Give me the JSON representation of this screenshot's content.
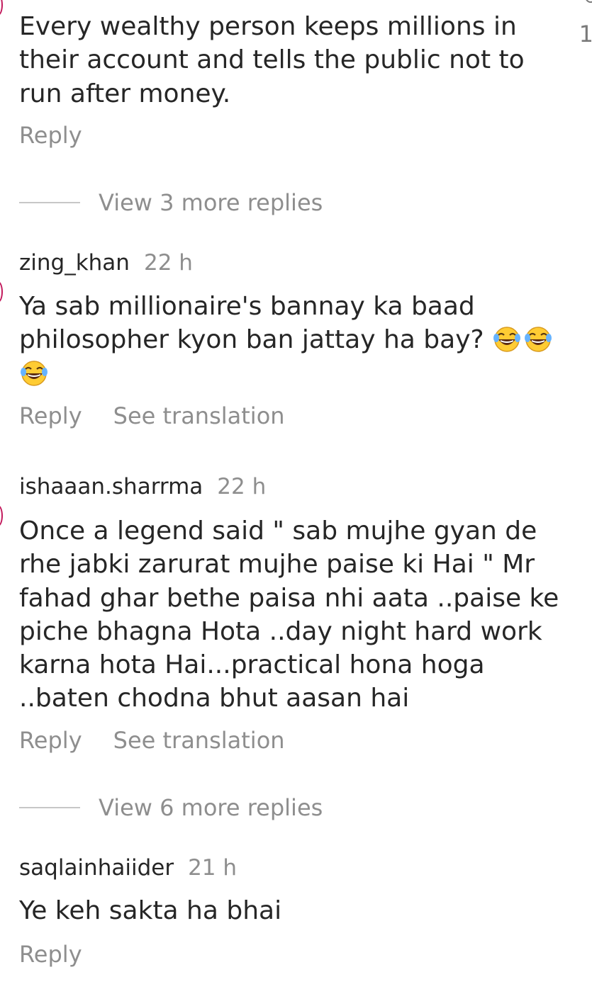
{
  "comments": [
    {
      "text": "Every wealthy person keeps millions in their account and tells the public not to run after money.",
      "reply_label": "Reply"
    },
    {
      "username": "zing_khan",
      "time": "22 h",
      "text": "Ya sab millionaire's bannay ka baad philosopher kyon ban jattay ha bay?",
      "emoji": [
        "face-with-tears-of-joy-icon",
        "face-with-tears-of-joy-icon",
        "face-with-tears-of-joy-icon"
      ],
      "reply_label": "Reply",
      "translate_label": "See translation"
    },
    {
      "username": "ishaaan.sharrma",
      "time": "22 h",
      "text": "Once a legend said \" sab mujhe gyan de rhe jabki zarurat mujhe paise ki Hai \" Mr fahad ghar bethe paisa nhi aata ..paise ke piche bhagna Hota ..day night hard work karna hota Hai...practical hona hoga ..baten chodna bhut aasan hai",
      "reply_label": "Reply",
      "translate_label": "See translation"
    },
    {
      "username": "saqlainhaiider",
      "time": "21 h",
      "text": "Ye keh sakta ha bhai",
      "reply_label": "Reply"
    }
  ],
  "view_more": [
    {
      "label": "View 3 more replies"
    },
    {
      "label": "View 6 more replies"
    }
  ],
  "right_edge_glyph": "1",
  "accent_color": "#c2185b"
}
